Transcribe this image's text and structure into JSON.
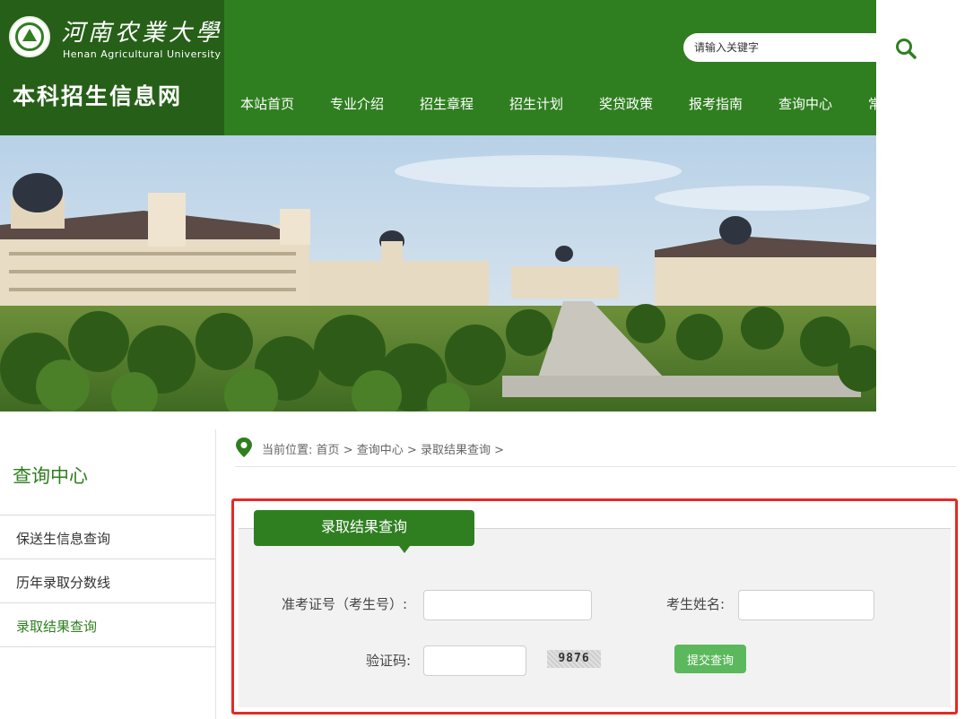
{
  "header": {
    "university_cn": "河南农業大學",
    "university_en": "Henan Agricultural University",
    "site_name": "本科招生信息网",
    "search_placeholder": "请输入关键字",
    "brand_color": "#2f7f20"
  },
  "nav": {
    "items": [
      {
        "label": "本站首页",
        "active": true
      },
      {
        "label": "专业介绍"
      },
      {
        "label": "招生章程"
      },
      {
        "label": "招生计划"
      },
      {
        "label": "奖贷政策"
      },
      {
        "label": "报考指南"
      },
      {
        "label": "查询中心"
      },
      {
        "label": "常"
      }
    ]
  },
  "sidebar": {
    "title": "查询中心",
    "items": [
      {
        "label": "保送生信息查询"
      },
      {
        "label": "历年录取分数线"
      },
      {
        "label": "录取结果查询",
        "active": true
      }
    ]
  },
  "breadcrumb": {
    "prefix": "当前位置:",
    "items": [
      "首页",
      "查询中心",
      "录取结果查询"
    ],
    "separator": ">"
  },
  "form": {
    "tab_title": "录取结果查询",
    "exam_id_label": "准考证号（考生号）:",
    "exam_id_value": "",
    "name_label": "考生姓名:",
    "name_value": "",
    "captcha_label": "验证码:",
    "captcha_value": "",
    "captcha_text": "9876",
    "submit_label": "提交查询",
    "submit_color": "#5cb85c",
    "highlight_color": "#e22b26"
  }
}
